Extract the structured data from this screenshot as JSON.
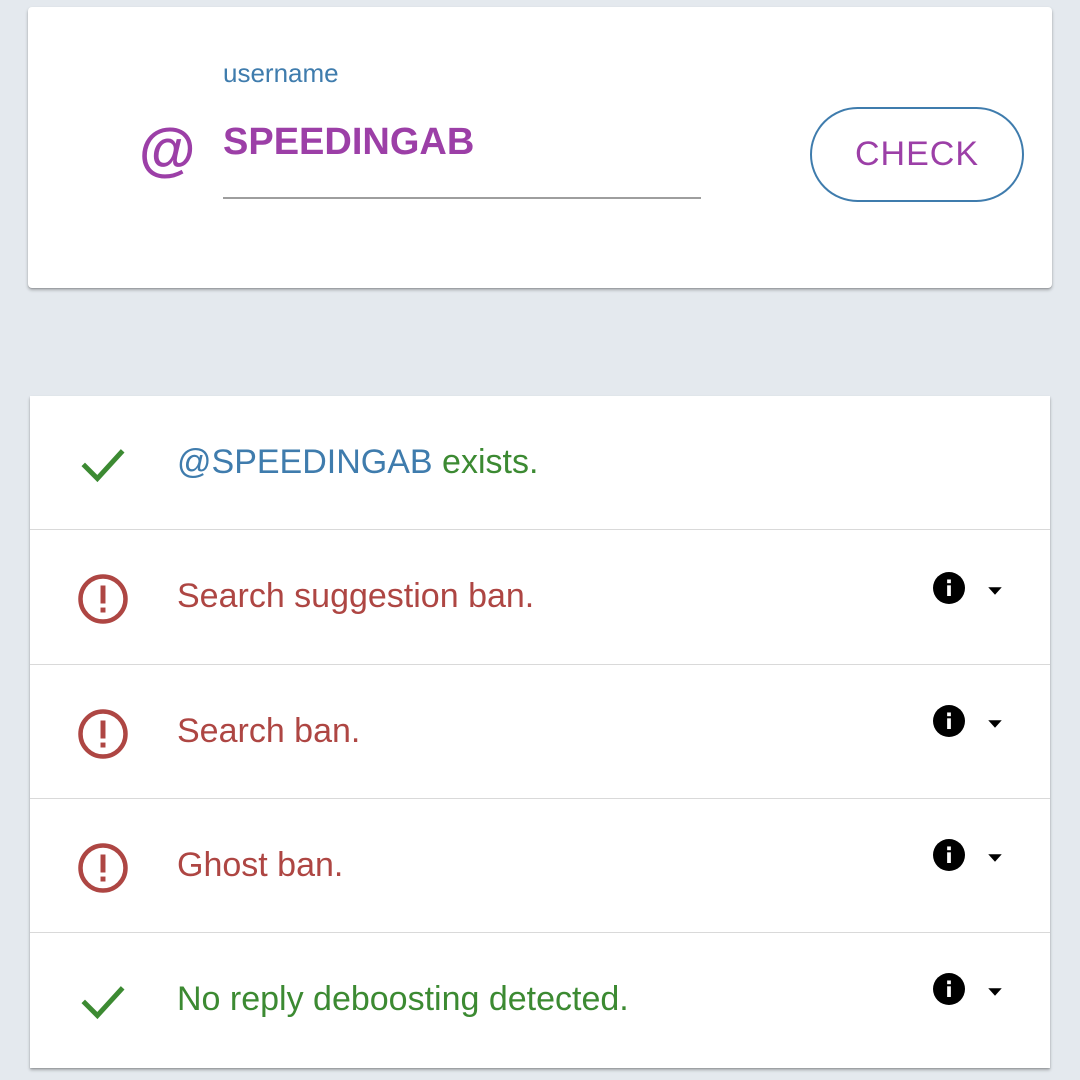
{
  "colors": {
    "background": "#e4e9ee",
    "accent_purple": "#9c3fa7",
    "accent_blue": "#3f7cad",
    "status_bad": "#ae4643",
    "status_good": "#3c8a32"
  },
  "form": {
    "at_symbol": "@",
    "label": "username",
    "username_value": "SPEEDINGAB",
    "check_label": "CHECK"
  },
  "results": {
    "exists": {
      "icon": "checkmark-icon",
      "handle": "@SPEEDINGAB",
      "suffix": " exists."
    },
    "search_suggestion_ban": {
      "icon": "alert-circle-icon",
      "text": "Search suggestion ban.",
      "info_icon": "info-icon",
      "expand_icon": "caret-down-icon"
    },
    "search_ban": {
      "icon": "alert-circle-icon",
      "text": "Search ban.",
      "info_icon": "info-icon",
      "expand_icon": "caret-down-icon"
    },
    "ghost_ban": {
      "icon": "alert-circle-icon",
      "text": "Ghost ban.",
      "info_icon": "info-icon",
      "expand_icon": "caret-down-icon"
    },
    "reply_deboosting": {
      "icon": "checkmark-icon",
      "text": "No reply deboosting detected.",
      "info_icon": "info-icon",
      "expand_icon": "caret-down-icon"
    }
  }
}
